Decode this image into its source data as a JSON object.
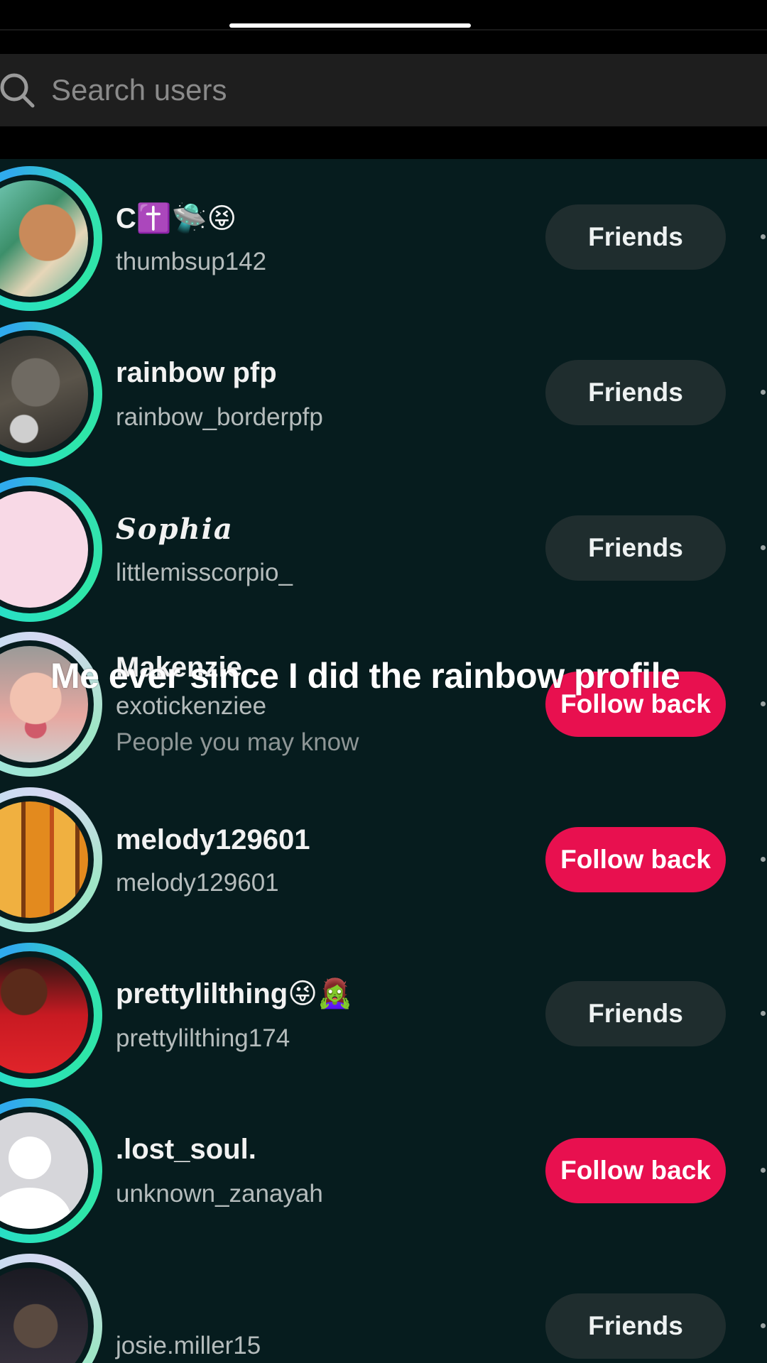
{
  "search": {
    "placeholder": "Search users"
  },
  "caption": "Me ever since I did the rainbow profile",
  "users": [
    {
      "name": "C✝️🛸😝",
      "handle": "thumbsup142",
      "button": "Friends",
      "avatar_icon": "photo-avatar"
    },
    {
      "name": "rainbow pfp",
      "handle": "rainbow_borderpfp",
      "button": "Friends",
      "avatar_icon": "cat-photo-avatar"
    },
    {
      "name": "𝑺𝒐𝒑𝒉𝒊𝒂",
      "handle": "littlemisscorpio_",
      "button": "Friends",
      "avatar_icon": "pink-avatar"
    },
    {
      "name": "Makenzie",
      "handle": "exotickenziee",
      "sub": "People you may know",
      "button": "Follow back",
      "avatar_icon": "photo-avatar"
    },
    {
      "name": "melody129601",
      "handle": "melody129601",
      "button": "Follow back",
      "avatar_icon": "drinks-photo-avatar"
    },
    {
      "name": "prettylilthing😜🧟‍♀️",
      "handle": "prettylilthing174",
      "button": "Friends",
      "avatar_icon": "photo-avatar"
    },
    {
      "name": ".lost_soul.",
      "handle": "unknown_zanayah",
      "button": "Follow back",
      "avatar_icon": "default-person-avatar"
    },
    {
      "name": "",
      "handle": "josie.miller15",
      "button": "Friends",
      "avatar_icon": "photo-avatar"
    }
  ],
  "colors": {
    "background": "#061c1e",
    "follow_back": "#e8104f",
    "friends_button": "#1f2d2e",
    "ring_gradient": [
      "#29e0c4",
      "#22c2e6",
      "#31a9ee"
    ]
  }
}
